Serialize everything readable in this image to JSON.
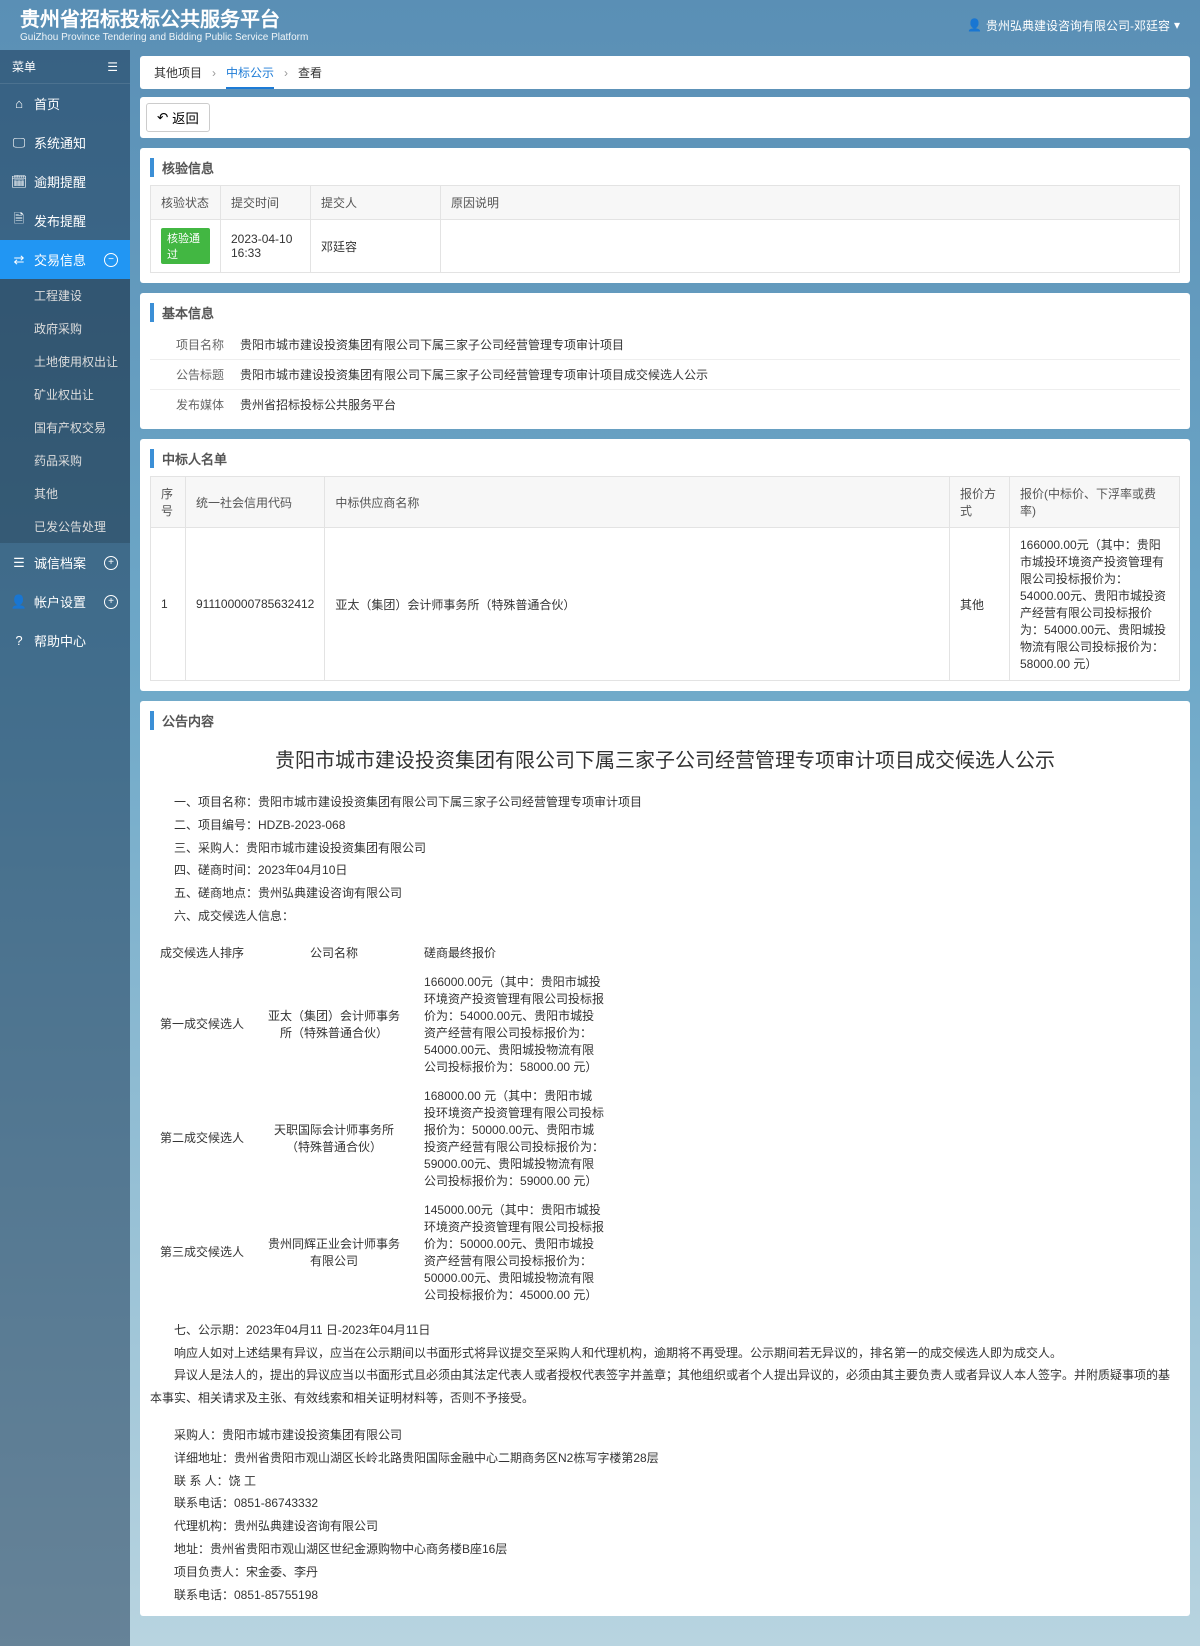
{
  "header": {
    "title": "贵州省招标投标公共服务平台",
    "subtitle": "GuiZhou Province Tendering and Bidding Public Service Platform",
    "user": "贵州弘典建设咨询有限公司-邓廷容"
  },
  "sidebar": {
    "menu_label": "菜单",
    "items": [
      {
        "label": "首页"
      },
      {
        "label": "系统通知"
      },
      {
        "label": "逾期提醒"
      },
      {
        "label": "发布提醒"
      },
      {
        "label": "交易信息",
        "active": true
      }
    ],
    "submenu": [
      "工程建设",
      "政府采购",
      "土地使用权出让",
      "矿业权出让",
      "国有产权交易",
      "药品采购",
      "其他",
      "已发公告处理"
    ],
    "items_after": [
      {
        "label": "诚信档案"
      },
      {
        "label": "帐户设置"
      },
      {
        "label": "帮助中心"
      }
    ]
  },
  "breadcrumb": {
    "a": "其他项目",
    "b": "中标公示",
    "c": "查看"
  },
  "back_label": "返回",
  "verify": {
    "title": "核验信息",
    "headers": {
      "status": "核验状态",
      "time": "提交时间",
      "submitter": "提交人",
      "reason": "原因说明"
    },
    "row": {
      "status": "核验通过",
      "time": "2023-04-10 16:33",
      "submitter": "邓廷容",
      "reason": ""
    }
  },
  "basic": {
    "title": "基本信息",
    "labels": {
      "name": "项目名称",
      "ann": "公告标题",
      "media": "发布媒体"
    },
    "values": {
      "name": "贵阳市城市建设投资集团有限公司下属三家子公司经营管理专项审计项目",
      "ann": "贵阳市城市建设投资集团有限公司下属三家子公司经营管理专项审计项目成交候选人公示",
      "media": "贵州省招标投标公共服务平台"
    }
  },
  "winners": {
    "title": "中标人名单",
    "headers": {
      "seq": "序号",
      "code": "统一社会信用代码",
      "supplier": "中标供应商名称",
      "method": "报价方式",
      "price": "报价(中标价、下浮率或费率)"
    },
    "rows": [
      {
        "seq": "1",
        "code": "911100000785632412",
        "supplier": "亚太（集团）会计师事务所（特殊普通合伙）",
        "method": "其他",
        "price": "166000.00元（其中：贵阳市城投环境资产投资管理有限公司投标报价为：54000.00元、贵阳市城投资产经营有限公司投标报价为：54000.00元、贵阳城投物流有限公司投标报价为：58000.00 元）"
      }
    ]
  },
  "announce": {
    "title": "公告内容",
    "main_title": "贵阳市城市建设投资集团有限公司下属三家子公司经营管理专项审计项目成交候选人公示",
    "lines": [
      "一、项目名称：贵阳市城市建设投资集团有限公司下属三家子公司经营管理专项审计项目",
      "二、项目编号：HDZB-2023-068",
      "三、采购人：贵阳市城市建设投资集团有限公司",
      "四、磋商时间：2023年04月10日",
      "五、磋商地点：贵州弘典建设咨询有限公司",
      "六、成交候选人信息："
    ],
    "cand_head": {
      "rank": "成交候选人排序",
      "company": "公司名称",
      "price": "磋商最终报价"
    },
    "candidates": [
      {
        "rank": "第一成交候选人",
        "company": "亚太（集团）会计师事务所（特殊普通合伙）",
        "price": "166000.00元（其中：贵阳市城投环境资产投资管理有限公司投标报价为：54000.00元、贵阳市城投资产经营有限公司投标报价为：54000.00元、贵阳城投物流有限公司投标报价为：58000.00 元）"
      },
      {
        "rank": "第二成交候选人",
        "company": "天职国际会计师事务所（特殊普通合伙）",
        "price": "168000.00 元（其中：贵阳市城投环境资产投资管理有限公司投标报价为：50000.00元、贵阳市城投资产经营有限公司投标报价为： 59000.00元、贵阳城投物流有限公司投标报价为：59000.00 元）"
      },
      {
        "rank": "第三成交候选人",
        "company": "贵州同辉正业会计师事务有限公司",
        "price": "145000.00元（其中：贵阳市城投环境资产投资管理有限公司投标报价为：50000.00元、贵阳市城投资产经营有限公司投标报价为：50000.00元、贵阳城投物流有限公司投标报价为：45000.00 元）"
      }
    ],
    "period": "七、公示期：2023年04月11   日-2023年04月11日",
    "notes": [
      "响应人如对上述结果有异议，应当在公示期间以书面形式将异议提交至采购人和代理机构，逾期将不再受理。公示期间若无异议的，排名第一的成交候选人即为成交人。",
      "异议人是法人的，提出的异议应当以书面形式且必须由其法定代表人或者授权代表签字并盖章；其他组织或者个人提出异议的，必须由其主要负责人或者异议人本人签字。并附质疑事项的基本事实、相关请求及主张、有效线索和相关证明材料等，否则不予接受。"
    ],
    "contact": [
      "采购人：贵阳市城市建设投资集团有限公司",
      "详细地址：贵州省贵阳市观山湖区长岭北路贵阳国际金融中心二期商务区N2栋写字楼第28层",
      "联 系 人：饶 工",
      "联系电话：0851-86743332",
      "代理机构：贵州弘典建设咨询有限公司",
      "地址：贵州省贵阳市观山湖区世纪金源购物中心商务楼B座16层",
      "项目负责人：宋金委、李丹",
      "联系电话：0851-85755198"
    ]
  }
}
